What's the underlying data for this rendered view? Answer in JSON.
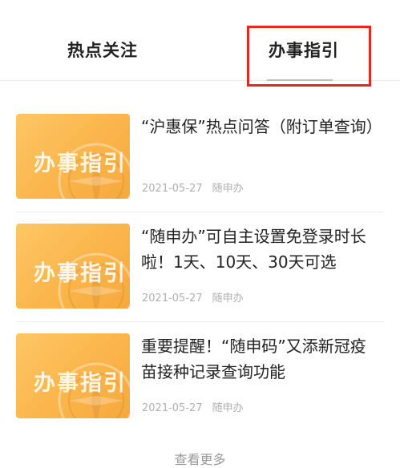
{
  "tabs": {
    "hot": "热点关注",
    "guide": "办事指引"
  },
  "thumbnail_text": "办事指引",
  "articles": [
    {
      "title": "“沪惠保”热点问答（附订单查询）",
      "date": "2021-05-27",
      "source": "随申办"
    },
    {
      "title": "“随申办”可自主设置免登录时长啦！1天、10天、30天可选",
      "date": "2021-05-27",
      "source": "随申办"
    },
    {
      "title": "重要提醒！“随申码”又添新冠疫苗接种记录查询功能",
      "date": "2021-05-27",
      "source": "随申办"
    }
  ],
  "more_label": "查看更多",
  "colors": {
    "highlight": "#e8271f",
    "thumbnail": "#fbb84f"
  }
}
